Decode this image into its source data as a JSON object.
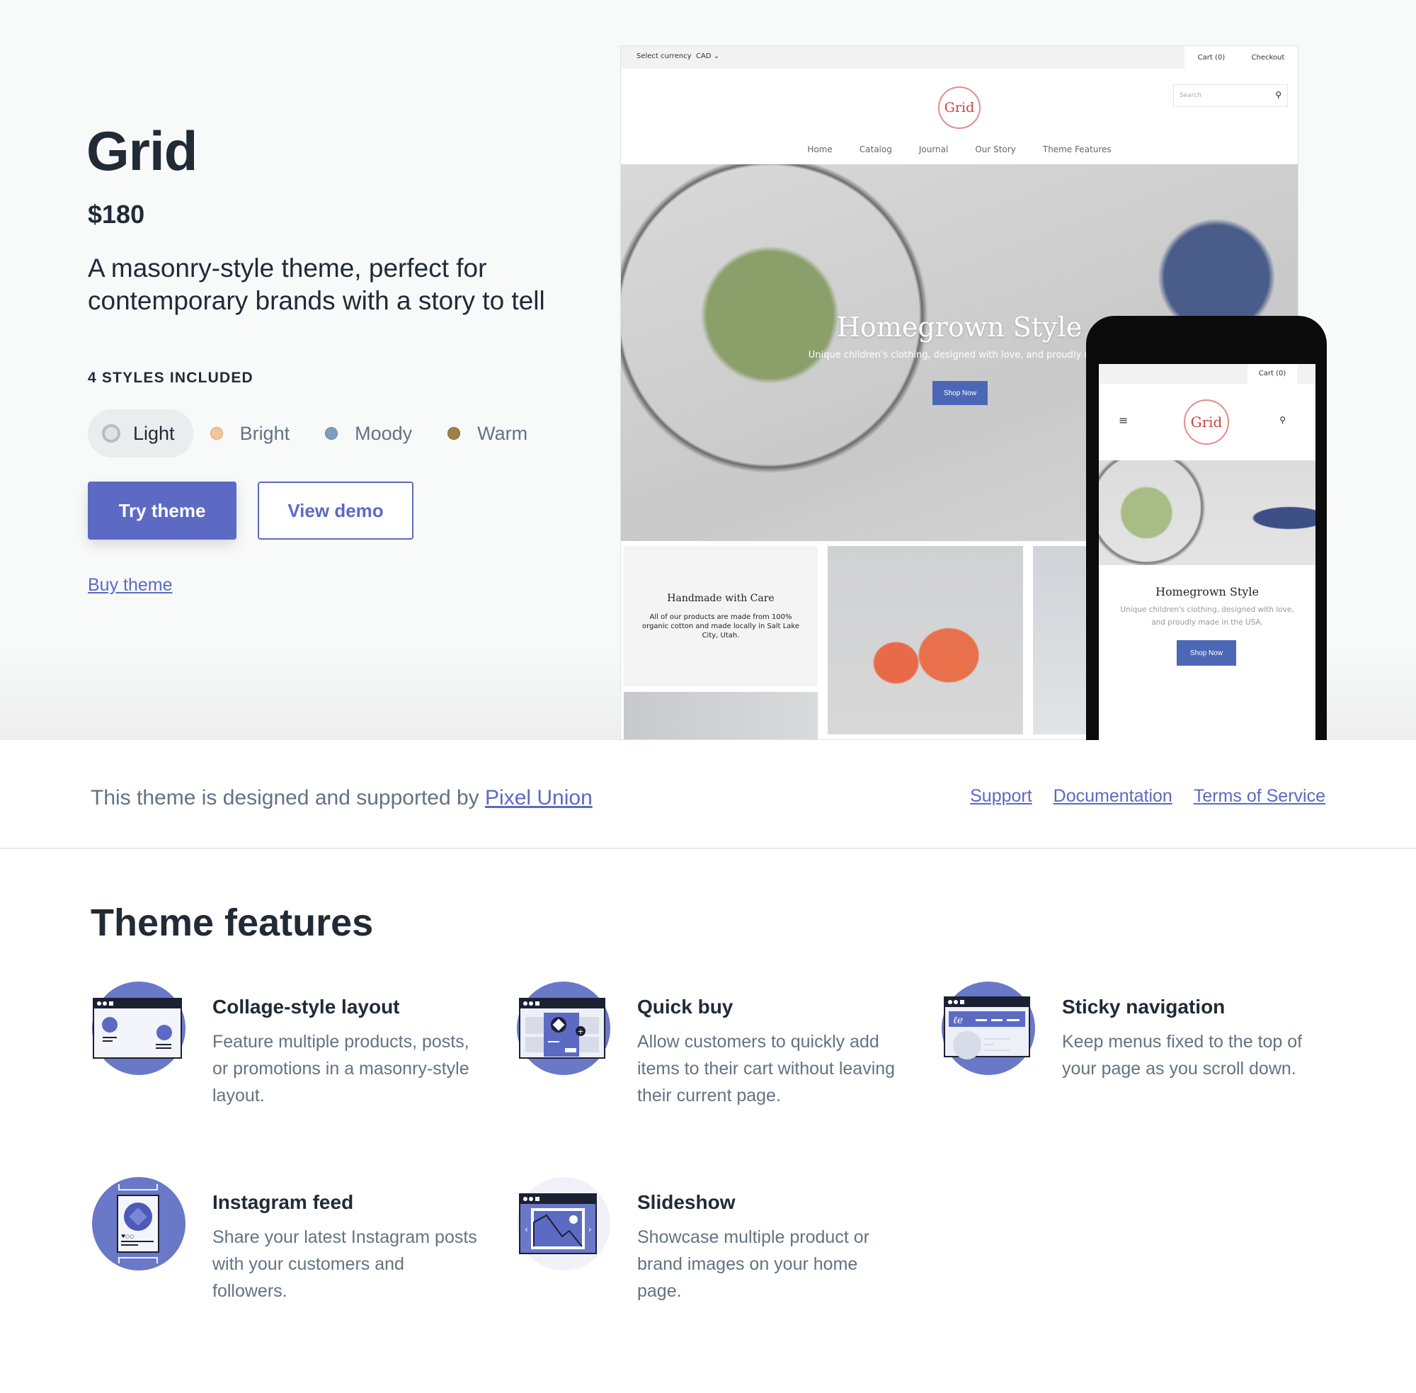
{
  "hero": {
    "title": "Grid",
    "price": "$180",
    "tagline": "A masonry-style theme, perfect for contemporary brands with a story to tell",
    "styles_label": "4 STYLES INCLUDED",
    "styles": [
      {
        "label": "Light",
        "color": "#dfe3e6",
        "selected": true
      },
      {
        "label": "Bright",
        "color": "#f7c49a",
        "selected": false
      },
      {
        "label": "Moody",
        "color": "#7f9dbf",
        "selected": false
      },
      {
        "label": "Warm",
        "color": "#9a8148",
        "selected": false
      }
    ],
    "try_button": "Try theme",
    "demo_button": "View demo",
    "buy_link": "Buy theme",
    "accent": "#5c6ac4"
  },
  "desktop_preview": {
    "currency_label": "Select currency",
    "currency_value": "CAD",
    "cart": "Cart (0)",
    "checkout": "Checkout",
    "logo": "Grid",
    "search_placeholder": "Search",
    "nav": [
      "Home",
      "Catalog",
      "Journal",
      "Our Story",
      "Theme Features"
    ],
    "hero_title": "Homegrown Style",
    "hero_subtitle": "Unique children's clothing, designed with love, and proudly made",
    "shop_button": "Shop Now",
    "tile_title": "Handmade with Care",
    "tile_text": "All of our products are made from 100% organic cotton and made locally in Salt Lake City, Utah."
  },
  "mobile_preview": {
    "cart": "Cart (0)",
    "logo": "Grid",
    "hero_title": "Homegrown Style",
    "hero_subtitle": "Unique children's clothing, designed with love, and proudly made in the USA.",
    "shop_button": "Shop Now"
  },
  "support": {
    "text": "This theme is designed and supported by",
    "author_link": "Pixel Union",
    "links": [
      "Support",
      "Documentation",
      "Terms of Service"
    ]
  },
  "features": {
    "title": "Theme features",
    "items": [
      {
        "icon": "collage-layout-icon",
        "title": "Collage-style layout",
        "description": "Feature multiple products, posts, or promotions in a masonry-style layout."
      },
      {
        "icon": "quick-buy-icon",
        "title": "Quick buy",
        "description": "Allow customers to quickly add items to their cart without leaving their current page."
      },
      {
        "icon": "sticky-navigation-icon",
        "title": "Sticky navigation",
        "description": "Keep menus fixed to the top of your page as you scroll down."
      },
      {
        "icon": "instagram-feed-icon",
        "title": "Instagram feed",
        "description": "Share your latest Instagram posts with your customers and followers."
      },
      {
        "icon": "slideshow-icon",
        "title": "Slideshow",
        "description": "Showcase multiple product or brand images on your home page."
      }
    ]
  }
}
